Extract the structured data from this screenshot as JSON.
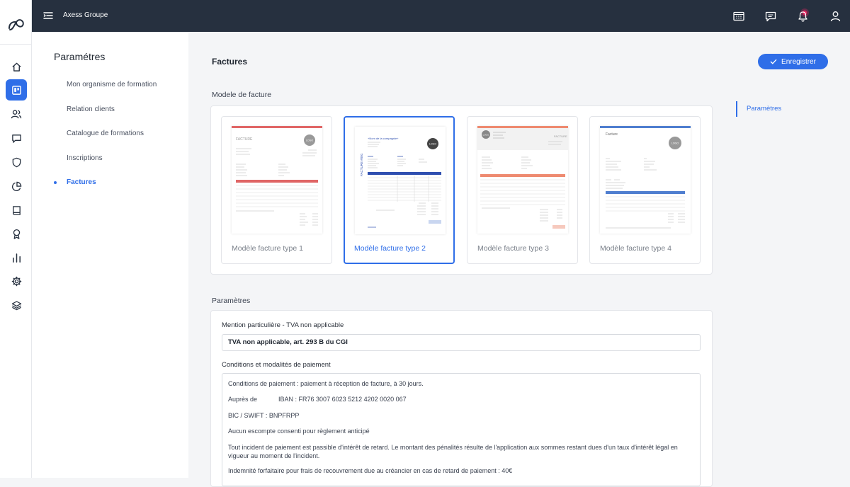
{
  "topbar": {
    "org_name": "Axess Groupe"
  },
  "rail": {
    "items": [
      "home-icon",
      "dashboard-icon",
      "users-icon",
      "chat-icon",
      "shield-icon",
      "pie-chart-icon",
      "book-icon",
      "award-icon",
      "bar-chart-icon",
      "settings-icon",
      "layers-icon"
    ],
    "active": "dashboard-icon"
  },
  "settings_nav": {
    "title": "Paramétres",
    "items": [
      "Mon organisme de formation",
      "Relation clients",
      "Catalogue de formations",
      "Inscriptions",
      "Factures"
    ],
    "active_index": 4
  },
  "main": {
    "title": "Factures",
    "save_label": "Enregistrer",
    "template_section_label": "Modele de facture",
    "templates": [
      "Modèle facture type 1",
      "Modèle facture type 2",
      "Modèle facture type 3",
      "Modèle facture type 4"
    ],
    "selected_template": 1,
    "params_section_label": "Paramètres",
    "mention_label": "Mention particulière - TVA non applicable",
    "mention_value": "TVA non applicable, art. 293 B du CGI",
    "conditions_label": "Conditions et modalités de paiement",
    "conditions_lines": [
      "Conditions de paiement : paiement à réception de facture, à 30 jours.",
      "Auprès de            IBAN : FR76 3007 6023 5212 4202 0020 067",
      "BIC / SWIFT : BNPFRPP",
      "Aucun escompte consenti pour règlement anticipé",
      "Tout incident de paiement est passible d'intérêt de retard. Le montant des pénalités résulte de l'application aux sommes restant dues d'un taux d'intérêt légal en vigueur au moment de l'incident.",
      "Indemnité forfaitaire pour frais de recouvrement due au créancier en cas de retard de paiement : 40€"
    ]
  },
  "right_panel": {
    "link": "Paramètres"
  },
  "thumbnails": {
    "t1_title": "FACTURE",
    "t1_logo": "LOGO",
    "t2_title": "FACTURE #001",
    "t2_company": "+Nom de la compagnie+",
    "t2_logo": "LOGO",
    "t3_title": "FACTURE",
    "t3_logo": "LOGO",
    "t4_title": "Facture",
    "t4_logo": "LOGO"
  },
  "colors": {
    "accent": "#2f6ee8",
    "topbar": "#26303f",
    "t1": "#e06666",
    "t2": "#2f4fb0",
    "t3": "#ee8a70",
    "t4": "#4f7ecf",
    "bell": "#e0245e"
  }
}
